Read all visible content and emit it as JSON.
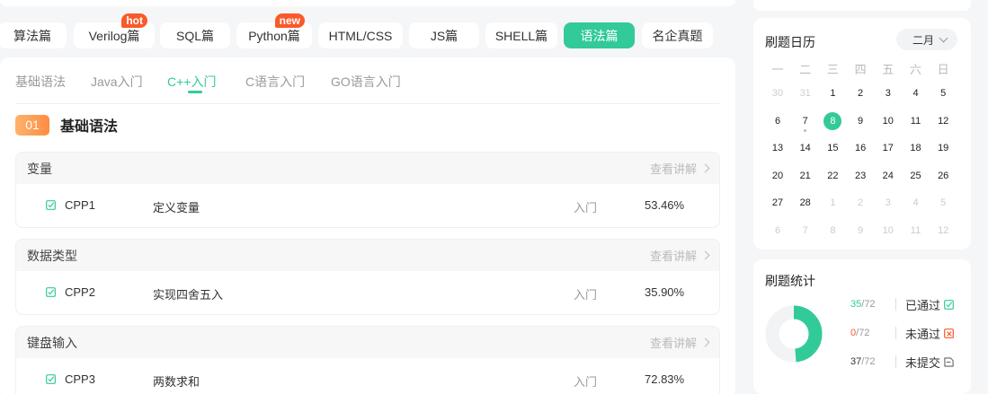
{
  "tabs": [
    {
      "label": "算法篇",
      "badge": ""
    },
    {
      "label": "Verilog篇",
      "badge": "hot"
    },
    {
      "label": "SQL篇",
      "badge": ""
    },
    {
      "label": "Python篇",
      "badge": "new"
    },
    {
      "label": "HTML/CSS",
      "badge": ""
    },
    {
      "label": "JS篇",
      "badge": ""
    },
    {
      "label": "SHELL篇",
      "badge": ""
    },
    {
      "label": "语法篇",
      "badge": ""
    },
    {
      "label": "名企真题",
      "badge": ""
    }
  ],
  "active_tab": "语法篇",
  "subtabs": [
    "基础语法",
    "Java入门",
    "C++入门",
    "C语言入门",
    "GO语言入门"
  ],
  "active_subtab": "C++入门",
  "section": {
    "number": "01",
    "title": "基础语法"
  },
  "detail_label": "查看讲解",
  "groups": [
    {
      "name": "变量",
      "row": {
        "code": "CPP1",
        "name": "定义变量",
        "level": "入门",
        "rate": "53.46%"
      }
    },
    {
      "name": "数据类型",
      "row": {
        "code": "CPP2",
        "name": "实现四舍五入",
        "level": "入门",
        "rate": "35.90%"
      }
    },
    {
      "name": "键盘输入",
      "row": {
        "code": "CPP3",
        "name": "两数求和",
        "level": "入门",
        "rate": "72.83%"
      }
    }
  ],
  "calendar": {
    "title": "刷题日历",
    "month": "二月",
    "weekdays": [
      "一",
      "二",
      "三",
      "四",
      "五",
      "六",
      "日"
    ],
    "weeks": [
      [
        "30",
        "31",
        "1",
        "2",
        "3",
        "4",
        "5"
      ],
      [
        "6",
        "7",
        "8",
        "9",
        "10",
        "11",
        "12"
      ],
      [
        "13",
        "14",
        "15",
        "16",
        "17",
        "18",
        "19"
      ],
      [
        "20",
        "21",
        "22",
        "23",
        "24",
        "25",
        "26"
      ],
      [
        "27",
        "28",
        "1",
        "2",
        "3",
        "4",
        "5"
      ],
      [
        "6",
        "7",
        "8",
        "9",
        "10",
        "11",
        "12"
      ]
    ],
    "today": "8",
    "marked_day": "7"
  },
  "stats": {
    "title": "刷题统计",
    "total": "72",
    "items": [
      {
        "count": "35",
        "label": "已通过",
        "color": "#32ca99",
        "icon": "check-square-icon"
      },
      {
        "count": "0",
        "label": "未通过",
        "color": "#fa5a2b",
        "icon": "x-square-icon"
      },
      {
        "count": "37",
        "label": "未提交",
        "color": "#333333",
        "icon": "file-icon"
      }
    ],
    "pass_fraction": 0.486
  },
  "colors": {
    "accent": "#32ca99",
    "orange": "#fe8d42",
    "red": "#fa5a2b"
  }
}
